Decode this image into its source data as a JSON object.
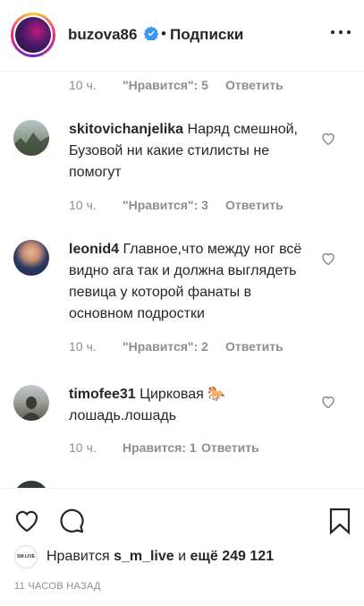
{
  "header": {
    "username": "buzova86",
    "separator": "•",
    "follow_label": "Подписки"
  },
  "comments": [
    {
      "time": "10 ч.",
      "likes": "\"Нравится\": 5",
      "reply": "Ответить"
    },
    {
      "username": "skitovichanjelika",
      "text": "Наряд смешной, Бузовой ни какие стилисты не помогут",
      "time": "10 ч.",
      "likes": "\"Нравится\": 3",
      "reply": "Ответить"
    },
    {
      "username": "leonid4",
      "text": "Главное,что между ног всё видно ага так и должна выглядеть певица у которой фанаты в основном подростки",
      "time": "10 ч.",
      "likes": "\"Нравится\": 2",
      "reply": "Ответить"
    },
    {
      "username": "timofee31",
      "text": "Цирковая 🐎 лошадь.лошадь",
      "time": "10 ч.",
      "likes": "Нравится: 1",
      "reply": "Ответить"
    }
  ],
  "footer": {
    "liked_prefix": "Нравится",
    "liked_user": "s_m_live",
    "liked_middle": "и",
    "liked_others": "ещё 249 121",
    "liked_avatar_text": "SM LIVE",
    "posted_ago": "11 ЧАСОВ НАЗАД"
  },
  "icons": {
    "verified": "verified-badge-icon",
    "more": "more-options-icon",
    "heart": "heart-icon",
    "comment": "comment-icon",
    "bookmark": "bookmark-icon"
  },
  "colors": {
    "verified_blue": "#3897f0",
    "meta_gray": "#8e8e8e",
    "text": "#262626"
  }
}
